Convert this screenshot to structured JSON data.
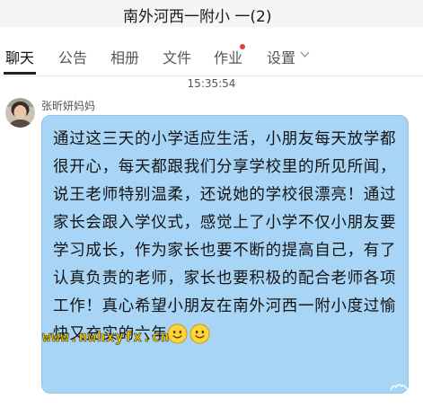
{
  "window": {
    "title": "南外河西一附小 一(2)"
  },
  "tabs": [
    {
      "label": "聊天",
      "active": true
    },
    {
      "label": "公告",
      "active": false
    },
    {
      "label": "相册",
      "active": false
    },
    {
      "label": "文件",
      "active": false
    },
    {
      "label": "作业",
      "active": false,
      "notification_dot": true
    },
    {
      "label": "设置",
      "active": false,
      "has_dropdown": true
    }
  ],
  "chat": {
    "timestamp": "15:35:54",
    "messages": [
      {
        "sender": "张昕妍妈妈",
        "text": "通过这三天的小学适应生活，小朋友每天放学都很开心，每天都跟我们分享学校里的所见所闻，说王老师特别温柔，还说她的学校很漂亮！通过家长会跟入学仪式，感觉上了小学不仅小朋友要学习成长，作为家长也要不断的提高自己，有了认真负责的老师，家长也要积极的配合老师各项工作！真心希望小朋友在南外河西一附小度过愉快又充实的六年",
        "emojis": [
          "smile-emoji",
          "smile-emoji"
        ]
      }
    ]
  },
  "watermark": "www.nwhxyfx.cn",
  "colors": {
    "bubble": "#a8d4f5",
    "notification_dot": "#e0433a",
    "watermark": "#f5d200"
  }
}
